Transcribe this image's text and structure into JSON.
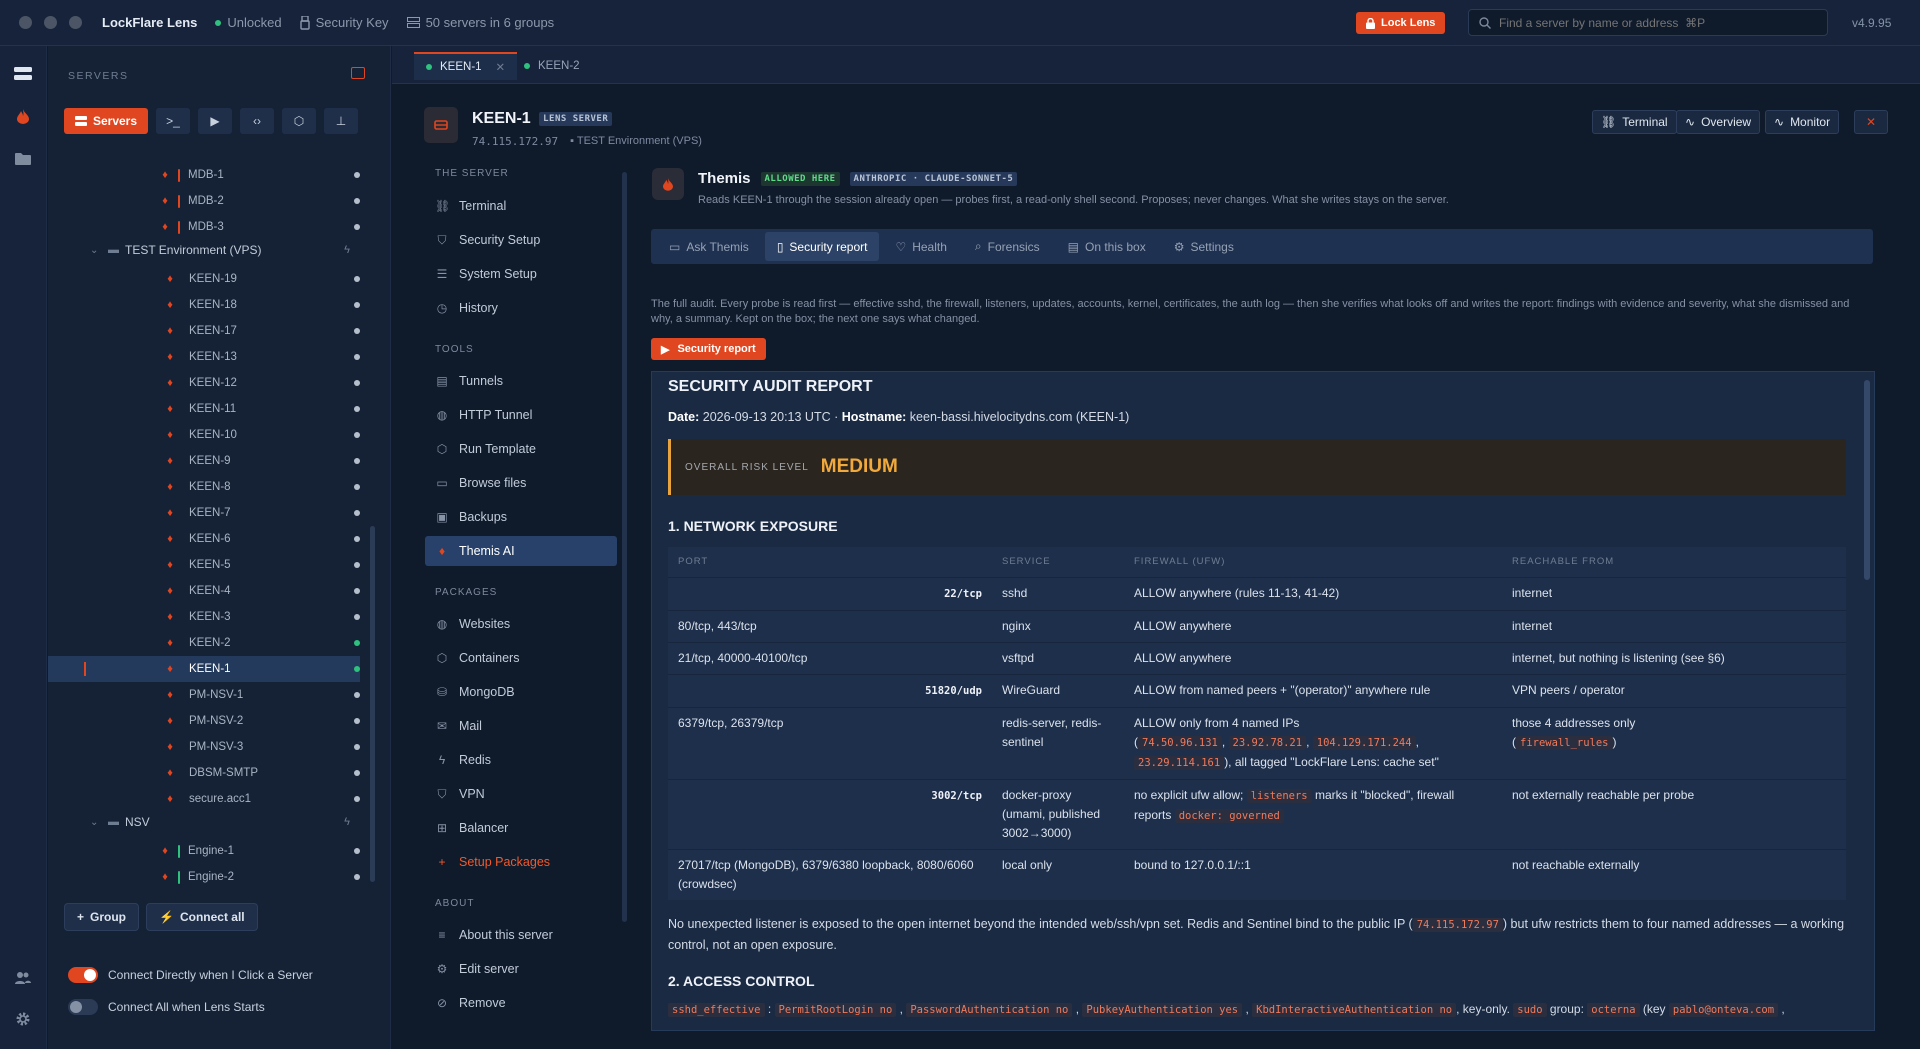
{
  "app": {
    "name": "LockFlare Lens",
    "status": "Unlocked",
    "key_label": "Security Key",
    "servers_summary": "50 servers in 6 groups",
    "lock_button": "Lock Lens",
    "search_placeholder": "Find a server by name or address",
    "search_shortcut": "⌘P",
    "version": "v4.9.95"
  },
  "sidebar": {
    "title": "SERVERS",
    "servers_button": "Servers",
    "group_button": "Group",
    "connect_all_button": "Connect all",
    "toggle_direct": "Connect Directly when I Click a Server",
    "toggle_direct_on": true,
    "toggle_all": "Connect All when Lens Starts",
    "toggle_all_on": false,
    "rows_a": [
      {
        "name": "MDB-1"
      },
      {
        "name": "MDB-2"
      },
      {
        "name": "MDB-3"
      }
    ],
    "group_test": "TEST Environment (VPS)",
    "rows_b": [
      {
        "name": "KEEN-19"
      },
      {
        "name": "KEEN-18"
      },
      {
        "name": "KEEN-17"
      },
      {
        "name": "KEEN-13"
      },
      {
        "name": "KEEN-12"
      },
      {
        "name": "KEEN-11"
      },
      {
        "name": "KEEN-10"
      },
      {
        "name": "KEEN-9"
      },
      {
        "name": "KEEN-8"
      },
      {
        "name": "KEEN-7"
      },
      {
        "name": "KEEN-6"
      },
      {
        "name": "KEEN-5"
      },
      {
        "name": "KEEN-4"
      },
      {
        "name": "KEEN-3"
      },
      {
        "name": "KEEN-2"
      },
      {
        "name": "KEEN-1"
      },
      {
        "name": "PM-NSV-1"
      },
      {
        "name": "PM-NSV-2"
      },
      {
        "name": "PM-NSV-3"
      },
      {
        "name": "DBSM-SMTP"
      },
      {
        "name": "secure.acc1"
      }
    ],
    "group_nsv": "NSV",
    "rows_c": [
      {
        "name": "Engine-1"
      },
      {
        "name": "Engine-2"
      }
    ]
  },
  "tabs": [
    {
      "label": "KEEN-1"
    },
    {
      "label": "KEEN-2"
    }
  ],
  "server": {
    "name": "KEEN-1",
    "badge": "LENS SERVER",
    "ip": "74.115.172.97",
    "group": "TEST Environment (VPS)",
    "btn_terminal": "Terminal",
    "btn_overview": "Overview",
    "btn_monitor": "Monitor"
  },
  "nav": {
    "sec_server": "THE SERVER",
    "terminal": "Terminal",
    "security_setup": "Security Setup",
    "system_setup": "System Setup",
    "history": "History",
    "sec_tools": "TOOLS",
    "tunnels": "Tunnels",
    "http_tunnel": "HTTP Tunnel",
    "run_template": "Run Template",
    "browse_files": "Browse files",
    "backups": "Backups",
    "themis_ai": "Themis AI",
    "sec_packages": "PACKAGES",
    "websites": "Websites",
    "containers": "Containers",
    "mongodb": "MongoDB",
    "mail": "Mail",
    "redis": "Redis",
    "vpn": "VPN",
    "balancer": "Balancer",
    "setup_packages": "Setup Packages",
    "sec_about": "ABOUT",
    "about": "About this server",
    "edit": "Edit server",
    "remove": "Remove"
  },
  "themis": {
    "name": "Themis",
    "badge_allowed": "ALLOWED HERE",
    "badge_model": "ANTHROPIC · CLAUDE-SONNET-5",
    "desc": "Reads KEEN-1 through the session already open — probes first, a read-only shell second. Proposes; never changes. What she writes stays on the server.",
    "tab_ask": "Ask Themis",
    "tab_report": "Security report",
    "tab_health": "Health",
    "tab_forensics": "Forensics",
    "tab_box": "On this box",
    "tab_settings": "Settings",
    "intro": "The full audit. Every probe is read first — effective sshd, the firewall, listeners, updates, accounts, kernel, certificates, the auth log — then she verifies what looks off and writes the report: findings with evidence and severity, what she dismissed and why, a summary. Kept on the box; the next one says what changed.",
    "run_button": "Security report"
  },
  "report": {
    "title": "SECURITY AUDIT REPORT",
    "date_label": "Date:",
    "date": "2026-09-13 20:13 UTC",
    "host_label": "Hostname:",
    "host": "keen-bassi.hivelocitydns.com (KEEN-1)",
    "risk_label": "OVERALL RISK LEVEL",
    "risk_value": "MEDIUM",
    "risk_color": "#f2a93b",
    "sec1": "1. NETWORK EXPOSURE",
    "col_port": "PORT",
    "col_service": "SERVICE",
    "col_firewall": "FIREWALL (UFW)",
    "col_reach": "REACHABLE FROM",
    "row1": {
      "port": "22/tcp",
      "service": "sshd",
      "fw": "ALLOW anywhere (rules 11-13, 41-42)",
      "reach": "internet"
    },
    "row2": {
      "port": "80/tcp, 443/tcp",
      "service": "nginx",
      "fw": "ALLOW anywhere",
      "reach": "internet"
    },
    "row3": {
      "port": "21/tcp, 40000-40100/tcp",
      "service": "vsftpd",
      "fw": "ALLOW anywhere",
      "reach": "internet, but nothing is listening (see §6)"
    },
    "row4": {
      "port": "51820/udp",
      "service": "WireGuard",
      "fw": "ALLOW from named peers + \"(operator)\" anywhere rule",
      "reach": "VPN peers / operator"
    },
    "row5": {
      "port": "6379/tcp, 26379/tcp",
      "service": "redis-server, redis-sentinel",
      "fw_a": "ALLOW only from 4 named IPs",
      "ip1": "74.50.96.131",
      "ip2": "23.92.78.21",
      "ip3": "104.129.171.244",
      "ip4": "23.29.114.161",
      "fw_b": "), all tagged \"LockFlare Lens: cache set\"",
      "reach_a": "those 4 addresses only",
      "reach_code": "firewall_rules"
    },
    "row6": {
      "port": "3002/tcp",
      "service": "docker-proxy (umami, published 3002→3000)",
      "fw_a": "no explicit ufw allow;",
      "code1": "listeners",
      "fw_b": "marks it \"blocked\", firewall reports",
      "code2": "docker: governed",
      "reach": "not externally reachable per probe"
    },
    "row7": {
      "port": "27017/tcp (MongoDB), 6379/6380 loopback, 8080/6060 (crowdsec)",
      "service": "local only",
      "fw": "bound to 127.0.0.1/::1",
      "reach": "not reachable externally"
    },
    "para_a": "No unexpected listener is exposed to the open internet beyond the intended web/ssh/vpn set. Redis and Sentinel bind to the public IP (",
    "para_ip": "74.115.172.97",
    "para_b": ") but ufw restricts them to four named addresses — a working control, not an open exposure.",
    "sec2": "2. ACCESS CONTROL",
    "ac_code1": "sshd_effective",
    "ac_code2": "PermitRootLogin no",
    "ac_code3": "PasswordAuthentication no",
    "ac_code4": "PubkeyAuthentication yes",
    "ac_code5": "KbdInteractiveAuthentication no",
    "ac_text1": ", key-only.",
    "ac_code6": "sudo",
    "ac_text2": "group:",
    "ac_code7": "octerna",
    "ac_text3": "(key",
    "ac_code8": "pablo@onteva.com"
  }
}
